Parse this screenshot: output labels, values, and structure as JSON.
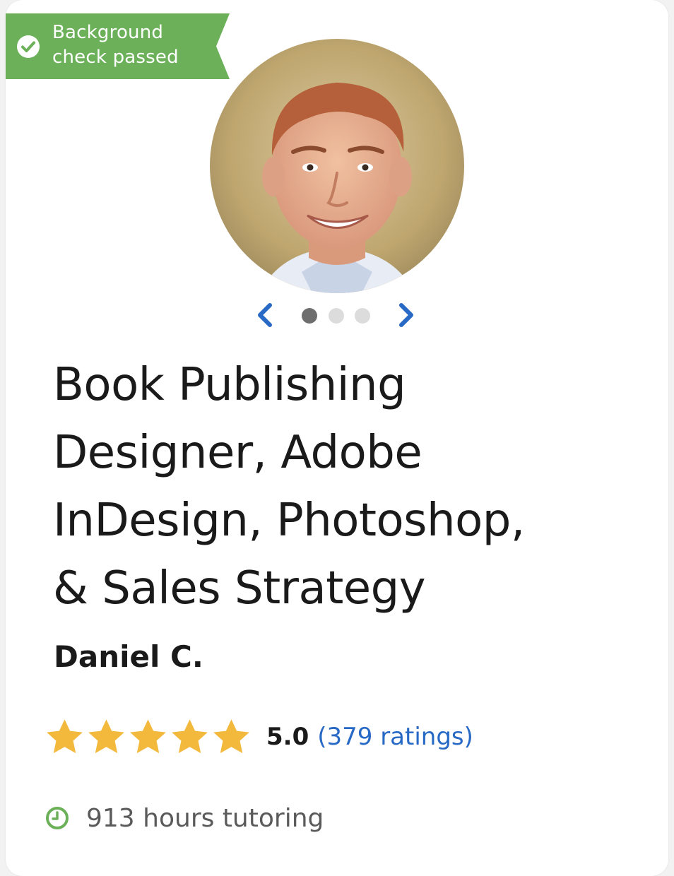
{
  "badge": {
    "line1": "Background",
    "line2": "check passed",
    "icon": "check-circle-icon",
    "color": "#6cb15a"
  },
  "photo": {
    "alt": "Daniel C. profile photo"
  },
  "carousel": {
    "prev_icon": "chevron-left-icon",
    "next_icon": "chevron-right-icon",
    "dot_count": 3,
    "active_index": 0,
    "accent": "#2769c5"
  },
  "title": {
    "line1": "Book Publishing",
    "line2": "Designer, Adobe",
    "line3": "InDesign, Photoshop,",
    "line4": "& Sales Strategy"
  },
  "tutor": {
    "name": "Daniel C."
  },
  "rating": {
    "stars": 5,
    "score": "5.0",
    "count_label": "(379 ratings)",
    "star_color": "#f2b93d",
    "link_color": "#2769c5"
  },
  "hours": {
    "label": "913 hours tutoring",
    "icon": "clock-icon",
    "icon_color": "#6cb15a"
  }
}
